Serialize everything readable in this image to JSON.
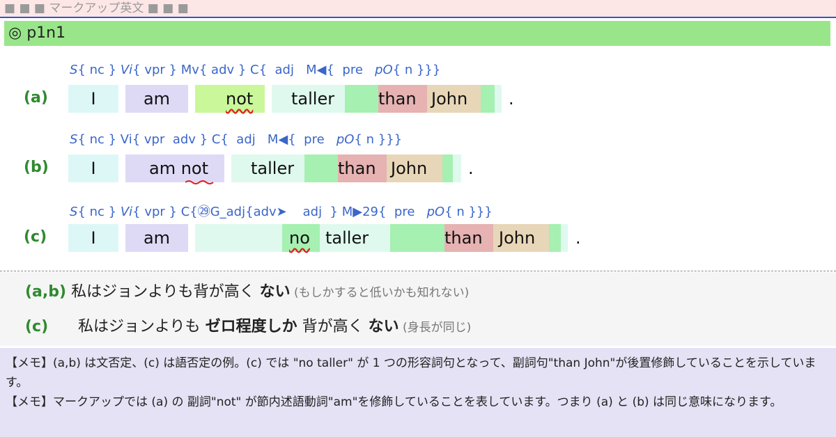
{
  "header": {
    "title": "■ ■ ■ マークアップ英文 ■ ■ ■"
  },
  "section": {
    "title": "◎ p1n1"
  },
  "examples": [
    {
      "label": "(a)",
      "annotation": [
        "S{",
        "nc",
        "}",
        "Vi{",
        "vpr",
        "}",
        "Mv{",
        "adv",
        "}",
        "C{",
        "adj",
        "M◀{",
        "pre",
        "pO{",
        "n",
        "}}}"
      ],
      "annotation_text": "S{ nc } Vi{ vpr } Mv{ adv } C{  adj   M◀{  pre   pO{ n }}}",
      "words": [
        "I",
        "am",
        "not",
        "taller",
        "than",
        "John",
        "."
      ]
    },
    {
      "label": "(b)",
      "annotation_text": "S{ nc } Vi{ vpr  adv } C{  adj   M◀{  pre   pO{ n }}}",
      "words": [
        "I",
        "am not",
        "taller",
        "than",
        "John",
        "."
      ]
    },
    {
      "label": "(c)",
      "annotation_text": "S{ nc } Vi{ vpr } C{㉙G_adj{adv➤    adj  } M▶29{  pre   pO{ n }}}",
      "words": [
        "I",
        "am",
        "no",
        "taller",
        "than",
        "John",
        "."
      ]
    }
  ],
  "translations": [
    {
      "tag": "(a,b)",
      "text": "私はジョンよりも背が高く ",
      "bold": "ない",
      "note": " (もしかすると低いかも知れない)"
    },
    {
      "tag": "(c)",
      "text1": "私はジョンよりも ",
      "bold1": "ゼロ程度しか",
      "text2": " 背が高く ",
      "bold2": "ない",
      "note": " (身長が同じ)"
    }
  ],
  "memos": [
    "【メモ】(a,b) は文否定、(c) は語否定の例。(c) では \"no taller\" が 1 つの形容詞句となって、副詞句\"than John\"が後置修飾していることを示しています。",
    "【メモ】マークアップでは (a) の 副詞\"not\" が節内述語動詞\"am\"を修飾していることを表しています。つまり (a) と (b) は同じ意味になります。"
  ],
  "colors": {
    "subject": "#ddf7f7",
    "verb": "#dedaf6",
    "adverb": "#c9f79a",
    "complement": "#dff9ef",
    "modifier": "#a6f0b2",
    "preposition": "#e6b2b2",
    "object": "#e8d6b8",
    "label_green": "#2f8a2f",
    "annotation_blue": "#3a66c9"
  }
}
